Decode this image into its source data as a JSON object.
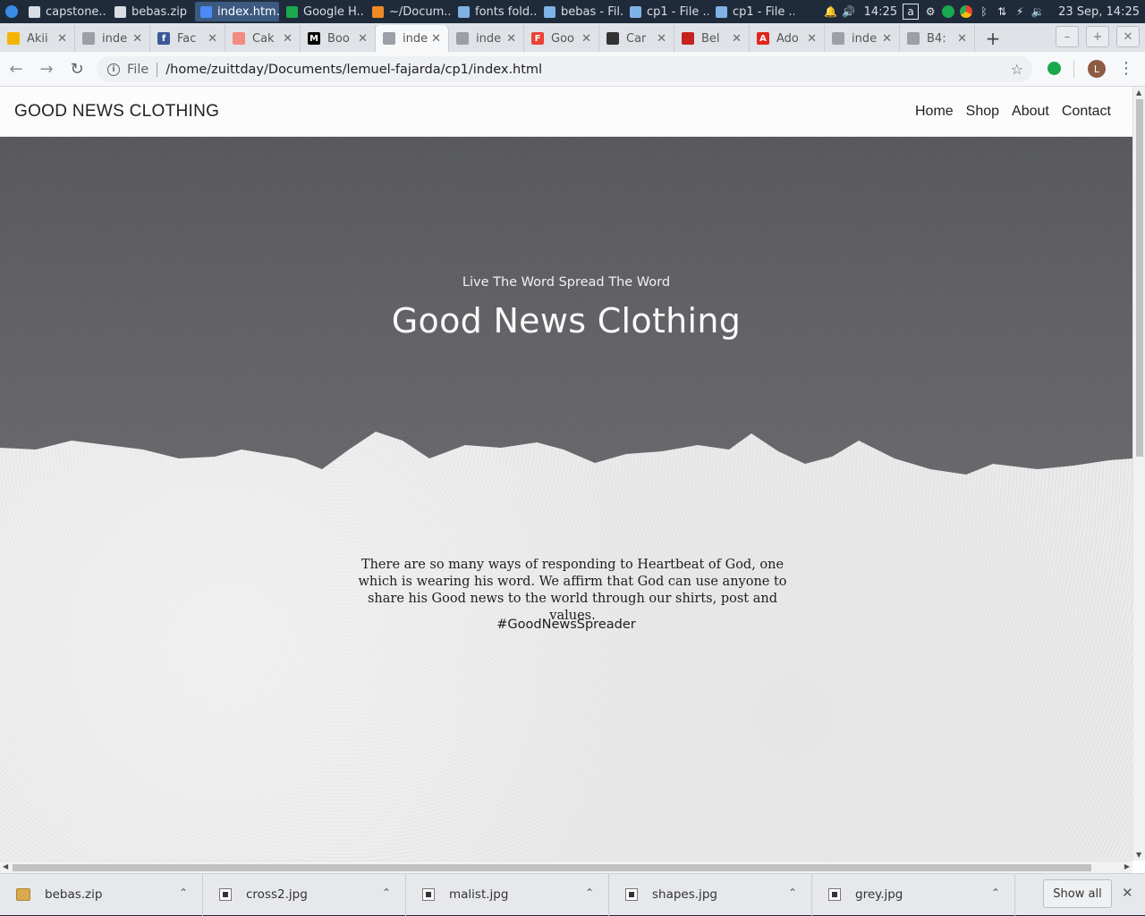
{
  "taskbar": {
    "tasks": [
      {
        "label": "capstone...",
        "color": "#d9dee5"
      },
      {
        "label": "bebas.zip",
        "color": "#d9dee5"
      },
      {
        "label": "index.htm...",
        "color": "#4c8bf5"
      },
      {
        "label": "Google H...",
        "color": "#1aa84f"
      },
      {
        "label": "~/Docum...",
        "color": "#f08a24"
      },
      {
        "label": "fonts fold...",
        "color": "#7fb2e5"
      },
      {
        "label": "bebas - Fil...",
        "color": "#7fb2e5"
      },
      {
        "label": "cp1 - File ...",
        "color": "#7fb2e5"
      },
      {
        "label": "cp1 - File ...",
        "color": "#7fb2e5"
      }
    ],
    "clock": "14:25",
    "date": "23 Sep, 14:25"
  },
  "browser": {
    "tabs": [
      {
        "label": "Akii",
        "fav": "",
        "favcolor": "#f4b400"
      },
      {
        "label": "inde",
        "fav": "",
        "favcolor": "#9aa0a6"
      },
      {
        "label": "Fac",
        "fav": "f",
        "favcolor": "#3b5998"
      },
      {
        "label": "Cak",
        "fav": "",
        "favcolor": "#f28b82"
      },
      {
        "label": "Boo",
        "fav": "M",
        "favcolor": "#000000"
      },
      {
        "label": "inde",
        "fav": "",
        "favcolor": "#9aa0a6"
      },
      {
        "label": "inde",
        "fav": "",
        "favcolor": "#9aa0a6"
      },
      {
        "label": "Goo",
        "fav": "F",
        "favcolor": "#ea4335"
      },
      {
        "label": "Car",
        "fav": "",
        "favcolor": "#333333"
      },
      {
        "label": "Bel",
        "fav": "",
        "favcolor": "#c5221f"
      },
      {
        "label": "Ado",
        "fav": "A",
        "favcolor": "#e1251b"
      },
      {
        "label": "inde",
        "fav": "",
        "favcolor": "#9aa0a6"
      },
      {
        "label": "B4:",
        "fav": "",
        "favcolor": "#9aa0a6"
      }
    ],
    "active_tab_index": 5,
    "scheme": "File",
    "url": "/home/zuittday/Documents/lemuel-fajarda/cp1/index.html",
    "profile_initial": "L"
  },
  "page": {
    "brand": "GOOD NEWS CLOTHING",
    "nav": [
      "Home",
      "Shop",
      "About",
      "Contact"
    ],
    "tagline": "Live The Word Spread The Word",
    "title": "Good News Clothing",
    "blurb": "There are so many ways of responding to Heartbeat of God, one which is wearing his word. We affirm that God can use anyone to share his Good news to the world through our shirts, post and values.",
    "hashtag": "#GoodNewsSpreader"
  },
  "downloads": {
    "items": [
      {
        "name": "bebas.zip",
        "type": "zip"
      },
      {
        "name": "cross2.jpg",
        "type": "img"
      },
      {
        "name": "malist.jpg",
        "type": "img"
      },
      {
        "name": "shapes.jpg",
        "type": "img"
      },
      {
        "name": "grey.jpg",
        "type": "img"
      }
    ],
    "show_all": "Show all"
  }
}
